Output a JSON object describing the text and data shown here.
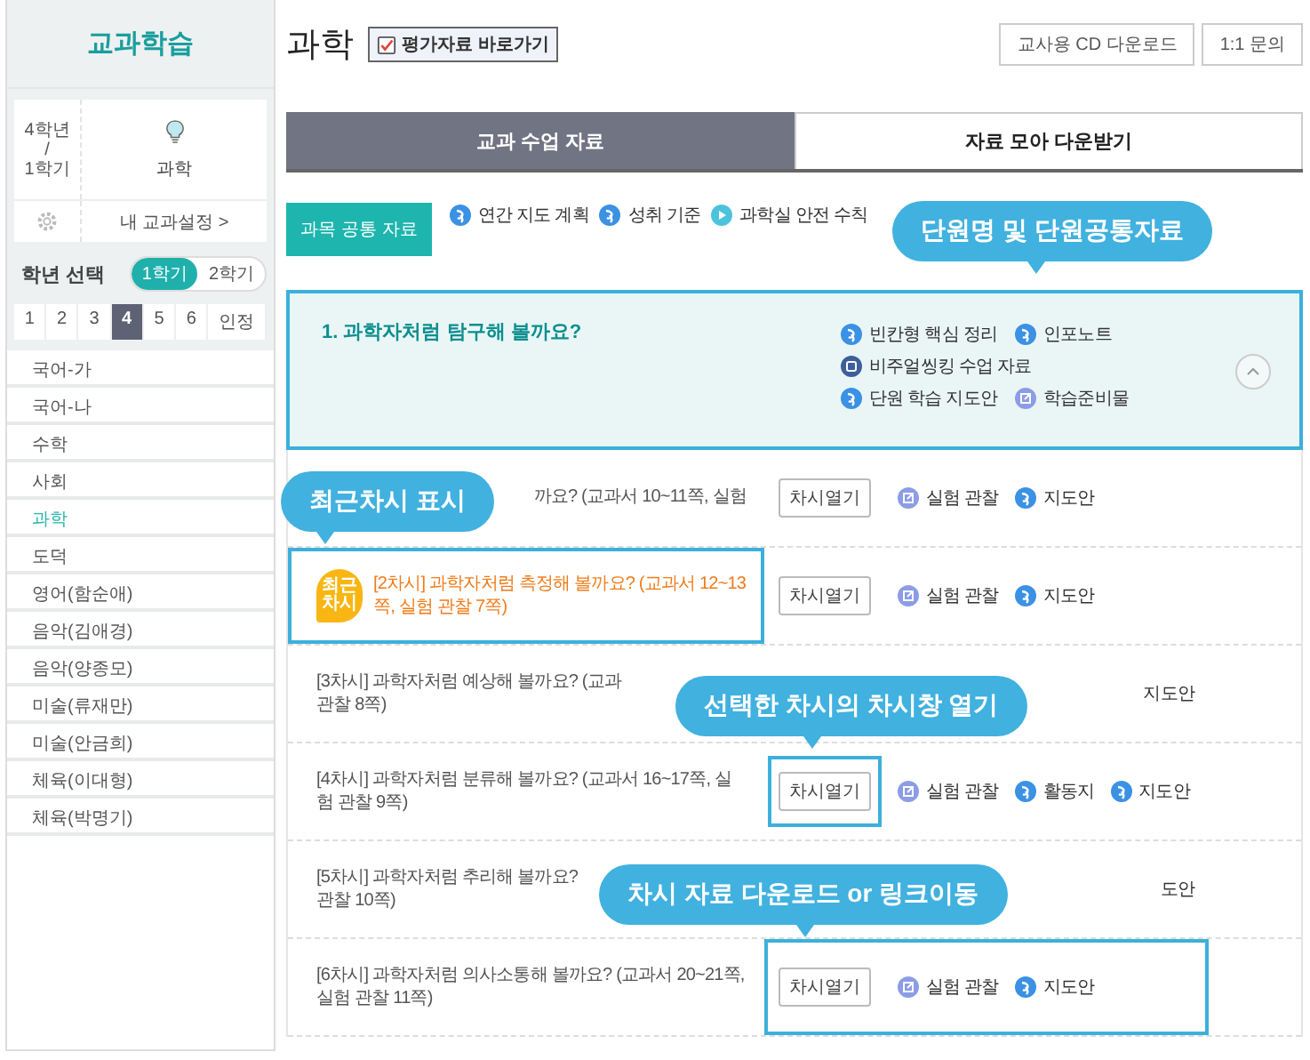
{
  "sidebar": {
    "title": "교과학습",
    "card": {
      "grade": "4학년\n/\n1학기",
      "subject": "과학",
      "settings_link": "내 교과설정 >"
    },
    "grade_select": {
      "label": "학년 선택",
      "semesters": [
        {
          "label": "1학기",
          "selected": true
        },
        {
          "label": "2학기",
          "selected": false
        }
      ],
      "grades": [
        {
          "label": "1",
          "selected": false
        },
        {
          "label": "2",
          "selected": false
        },
        {
          "label": "3",
          "selected": false
        },
        {
          "label": "4",
          "selected": true
        },
        {
          "label": "5",
          "selected": false
        },
        {
          "label": "6",
          "selected": false
        },
        {
          "label": "인정",
          "selected": false
        }
      ]
    },
    "subjects": [
      {
        "label": "국어-가",
        "selected": false
      },
      {
        "label": "국어-나",
        "selected": false
      },
      {
        "label": "수학",
        "selected": false
      },
      {
        "label": "사회",
        "selected": false
      },
      {
        "label": "과학",
        "selected": true
      },
      {
        "label": "도덕",
        "selected": false
      },
      {
        "label": "영어(함순애)",
        "selected": false
      },
      {
        "label": "음악(김애경)",
        "selected": false
      },
      {
        "label": "음악(양종모)",
        "selected": false
      },
      {
        "label": "미술(류재만)",
        "selected": false
      },
      {
        "label": "미술(안금희)",
        "selected": false
      },
      {
        "label": "체육(이대형)",
        "selected": false
      },
      {
        "label": "체육(박명기)",
        "selected": false
      }
    ]
  },
  "main": {
    "title": "과학",
    "eval_button": "평가자료 바로가기",
    "buttons": [
      "교사용 CD 다운로드",
      "1:1 문의"
    ],
    "tabs": [
      {
        "label": "교과 수업 자료",
        "selected": true
      },
      {
        "label": "자료 모아 다운받기",
        "selected": false
      }
    ],
    "common": {
      "label": "과목 공통 자료",
      "links": [
        {
          "label": "연간 지도 계획",
          "kind": "swirl"
        },
        {
          "label": "성취 기준",
          "kind": "swirl"
        },
        {
          "label": "과학실 안전 수칙",
          "kind": "play"
        }
      ]
    },
    "unit": {
      "title": "1. 과학자처럼 탐구해 볼까요?",
      "highlighted": true,
      "expanded": true,
      "links": [
        {
          "label": "빈칸형 핵심 정리",
          "kind": "swirl"
        },
        {
          "label": "인포노트",
          "kind": "swirl"
        },
        {
          "label": "비주얼씽킹 수업 자료",
          "kind": "square"
        },
        {
          "label": "단원 학습 지도안",
          "kind": "swirl"
        },
        {
          "label": "학습준비물",
          "kind": "external"
        }
      ]
    },
    "lessons": [
      {
        "title_lines": [
          "까요? (교과서 10~11쪽, 실험"
        ],
        "recent": false,
        "title_highlighted": false,
        "button_highlighted": false,
        "actions_highlighted": false,
        "button": "차시열기",
        "links": [
          {
            "label": "실험 관찰",
            "kind": "external"
          },
          {
            "label": "지도안",
            "kind": "swirl"
          }
        ]
      },
      {
        "badge": "최근 차시",
        "title_lines": [
          "[2차시] 과학자처럼 측정해 볼까요? (교과서 12~13쪽, 실험 관찰 7쪽)"
        ],
        "recent": true,
        "title_highlighted": true,
        "button_highlighted": false,
        "actions_highlighted": false,
        "button": "차시열기",
        "links": [
          {
            "label": "실험 관찰",
            "kind": "external"
          },
          {
            "label": "지도안",
            "kind": "swirl"
          }
        ]
      },
      {
        "title_lines": [
          "[3차시] 과학자처럼 예상해 볼까요? (교과",
          "관찰 8쪽)"
        ],
        "recent": false,
        "title_highlighted": false,
        "actions_highlighted": false,
        "links": [
          {
            "label": "지도안",
            "kind": "text"
          }
        ]
      },
      {
        "title_lines": [
          "[4차시] 과학자처럼 분류해 볼까요? (교과서 16~17쪽, 실험 관찰 9쪽)"
        ],
        "recent": false,
        "title_highlighted": false,
        "button_highlighted": true,
        "actions_highlighted": false,
        "button": "차시열기",
        "links": [
          {
            "label": "실험 관찰",
            "kind": "external"
          },
          {
            "label": "활동지",
            "kind": "swirl"
          },
          {
            "label": "지도안",
            "kind": "swirl"
          }
        ]
      },
      {
        "title_lines": [
          "[5차시] 과학자처럼 추리해 볼까요?",
          "관찰 10쪽)"
        ],
        "recent": false,
        "title_highlighted": false,
        "actions_highlighted": false,
        "links": [
          {
            "label": "도안",
            "kind": "text"
          }
        ]
      },
      {
        "title_lines": [
          "[6차시] 과학자처럼 의사소통해 볼까요? (교과서 20~21쪽, 실험 관찰 11쪽)"
        ],
        "recent": false,
        "title_highlighted": false,
        "button_highlighted": false,
        "actions_highlighted": true,
        "button": "차시열기",
        "links": [
          {
            "label": "실험 관찰",
            "kind": "external"
          },
          {
            "label": "지도안",
            "kind": "swirl"
          }
        ]
      }
    ]
  },
  "callouts": [
    "단원명 및 단원공통자료",
    "최근차시 표시",
    "선택한 차시의 차시창 열기",
    "차시 자료 다운로드 or 링크이동"
  ]
}
